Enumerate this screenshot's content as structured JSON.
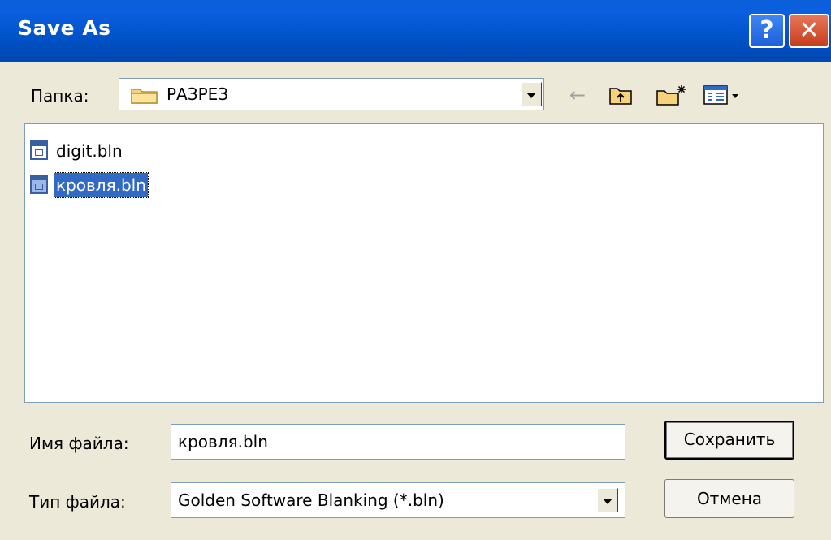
{
  "window": {
    "title": "Save As",
    "help_label": "?",
    "close_label": "✕"
  },
  "folder": {
    "label": "Папка:",
    "value": "РАЗРЕЗ"
  },
  "toolbar": {
    "back_icon": "back-arrow-icon",
    "up_icon": "up-folder-icon",
    "new_folder_icon": "new-folder-icon",
    "views_icon": "views-menu-icon"
  },
  "files": [
    {
      "name": "digit.bln",
      "selected": false
    },
    {
      "name": "кровля.bln",
      "selected": true
    }
  ],
  "filename": {
    "label": "Имя файла:",
    "value": "кровля.bln"
  },
  "filetype": {
    "label": "Тип файла:",
    "value": "Golden Software Blanking (*.bln)"
  },
  "buttons": {
    "save": "Сохранить",
    "cancel": "Отмена"
  },
  "colors": {
    "titlebar": "#0054e3",
    "selection": "#316ac5",
    "dialog_bg": "#ece9d8"
  }
}
